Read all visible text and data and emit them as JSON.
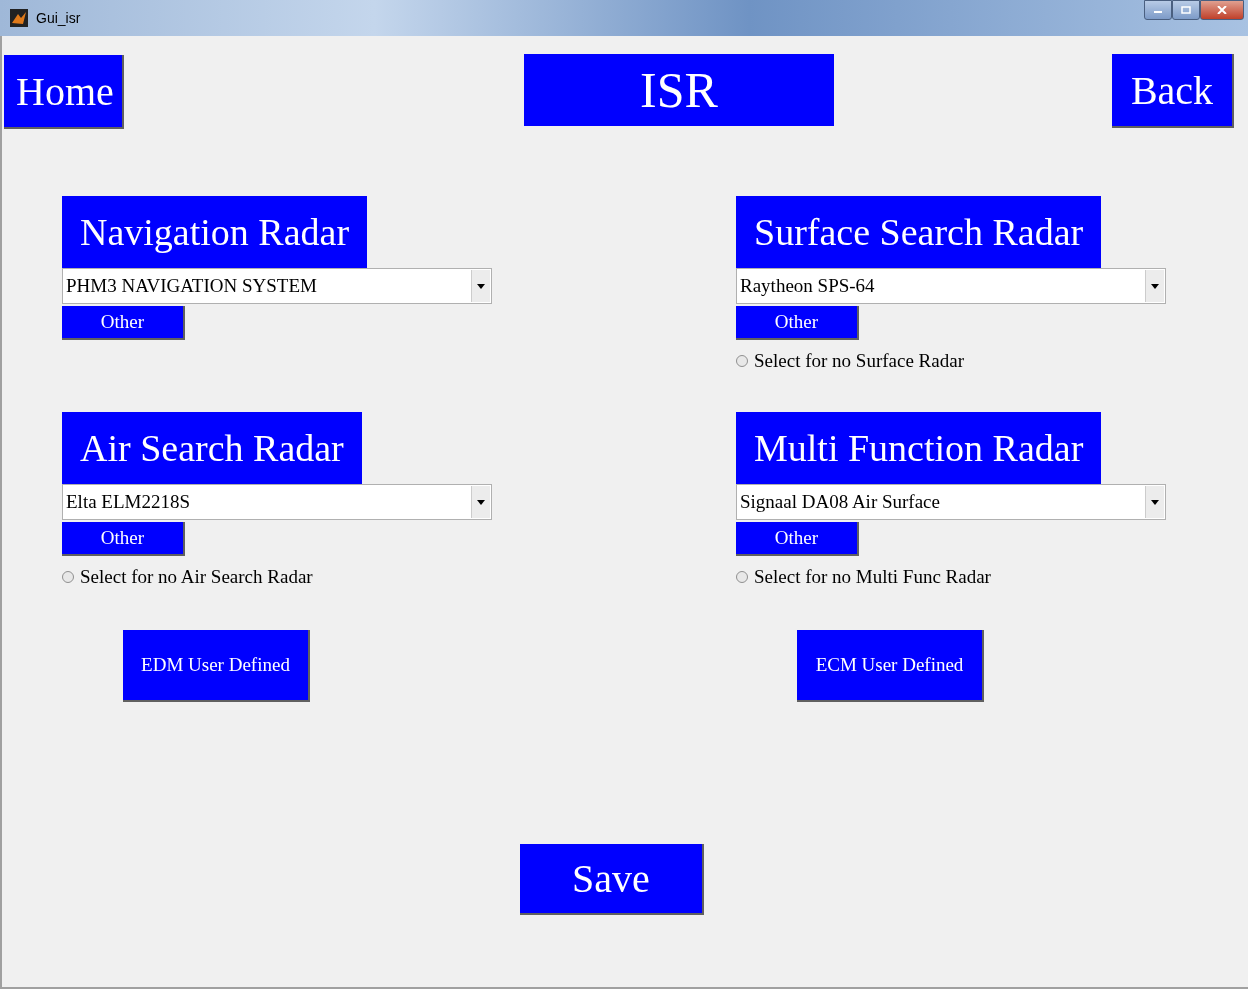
{
  "window": {
    "title": "Gui_isr"
  },
  "home_button": "Home",
  "title": "ISR",
  "back_button": "Back",
  "radars": [
    {
      "title": "Navigation Radar",
      "selection": "PHM3 NAVIGATION SYSTEM",
      "other_button": "Other"
    },
    {
      "title": "Surface Search Radar",
      "selection": "Raytheon SPS-64",
      "other_button": "Other",
      "no_radar_option": {
        "label": "Select for no Surface Radar",
        "selected": false
      }
    },
    {
      "title": "Air Search Radar",
      "selection": "Elta ELM2218S",
      "other_button": "Other",
      "no_radar_option": {
        "label": "Select for no Air Search Radar",
        "selected": false
      }
    },
    {
      "title": "Multi Function Radar",
      "selection": "Signaal DA08 Air Surface",
      "other_button": "Other",
      "no_radar_option": {
        "label": "Select for no Multi Func Radar",
        "selected": false
      }
    }
  ],
  "user_defined_buttons": [
    "EDM User Defined",
    "ECM User Defined"
  ],
  "save_button": "Save"
}
